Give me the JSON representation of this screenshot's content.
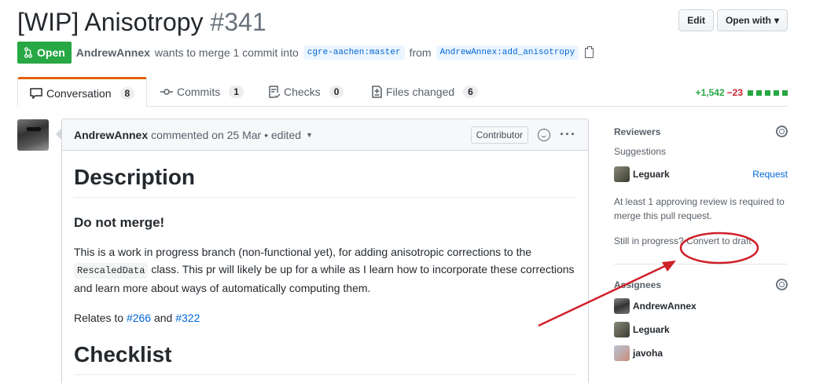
{
  "header": {
    "title": "[WIP] Anisotropy",
    "number": "#341",
    "edit_label": "Edit",
    "open_with_label": "Open with"
  },
  "meta": {
    "state": "Open",
    "author": "AndrewAnnex",
    "text_merge": "wants to merge 1 commit into",
    "base_ref": "cgre-aachen:master",
    "text_from": "from",
    "head_ref": "AndrewAnnex:add_anisotropy"
  },
  "tabs": [
    {
      "label": "Conversation",
      "count": "8"
    },
    {
      "label": "Commits",
      "count": "1"
    },
    {
      "label": "Checks",
      "count": "0"
    },
    {
      "label": "Files changed",
      "count": "6"
    }
  ],
  "diffstat": {
    "additions": "+1,542",
    "deletions": "−23",
    "add_color": "#28a745",
    "del_color": "#cb2431"
  },
  "comment": {
    "author": "AndrewAnnex",
    "text": "commented on 25 Mar • edited",
    "role": "Contributor",
    "h_description": "Description",
    "h_donotmerge": "Do not merge!",
    "para1_a": "This is a work in progress branch (non-functional yet), for adding anisotropic corrections to the",
    "code1": "RescaledData",
    "para1_b": "class. This pr will likely be up for a while as I learn how to incorporate these corrections and learn more about ways of automatically computing them.",
    "relates_prefix": "Relates to",
    "link1": "#266",
    "relates_and": "and",
    "link2": "#322",
    "h_checklist": "Checklist"
  },
  "sidebar": {
    "reviewers_title": "Reviewers",
    "suggestions": "Suggestions",
    "reviewer_name": "Leguark",
    "request_label": "Request",
    "approval_note": "At least 1 approving review is required to merge this pull request.",
    "still_prefix": "Still in progress?",
    "convert_label": "Convert to draft",
    "assignees_title": "Assignees",
    "assignees": [
      "AndrewAnnex",
      "Leguark",
      "javoha"
    ]
  },
  "annotation_color": "#d0202a"
}
